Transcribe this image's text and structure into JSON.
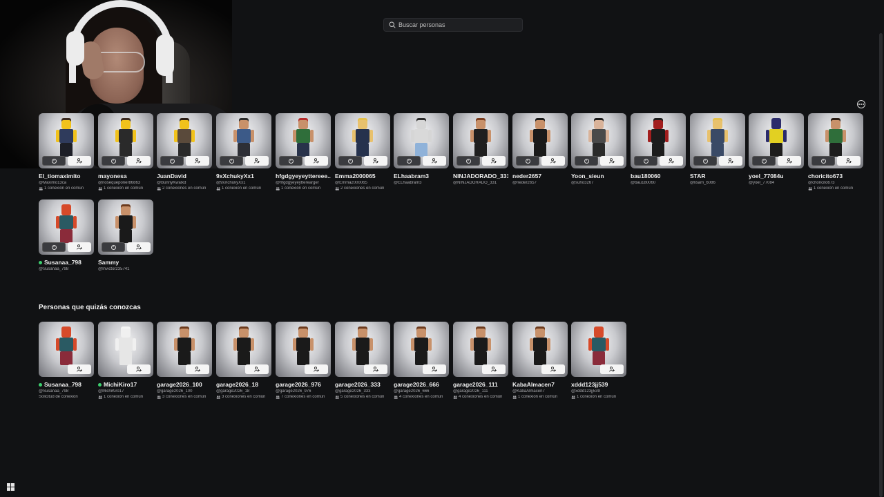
{
  "search": {
    "placeholder": "Buscar personas"
  },
  "colors": {
    "background": "#111214",
    "online": "#3ccf6e"
  },
  "requests": [
    {
      "name": "El_tiomaximito",
      "handle": "@Maximo13ca",
      "meta": "1 conexión en común",
      "head": "#f1c21b",
      "body": "#2f3b5c",
      "legs": "#1d1f27",
      "hair": "#3b2a1f"
    },
    {
      "name": "mayonesa",
      "handle": "@nosequeponer86863",
      "meta": "1 conexión en común",
      "head": "#f1c21b",
      "body": "#2a2a2a",
      "legs": "#2a2a2a",
      "hair": "#3b2a1f"
    },
    {
      "name": "JuanDavid",
      "handle": "@BunnyKwalxd",
      "meta": "2 conexiones en común",
      "head": "#f1c21b",
      "body": "#5a4a3b",
      "legs": "#2a2a2a",
      "hair": "#2b1d14"
    },
    {
      "name": "9xXchukyXx1",
      "handle": "@9xXchukyXx1",
      "meta": "1 conexión en común",
      "head": "#c8916a",
      "body": "#3c5a88",
      "legs": "#2d2f36",
      "hair": "#2a2a2a"
    },
    {
      "name": "hfgdgyeyeyttereee...",
      "handle": "@hfgdgyeyeytterearger",
      "meta": "1 conexión en común",
      "head": "#c8916a",
      "body": "#2f6e3a",
      "legs": "#28324a",
      "hair": "#b52a2a"
    },
    {
      "name": "Emma2000065",
      "handle": "@Emma2000065",
      "meta": "2 conexiones en común",
      "head": "#e8c16d",
      "body": "#26324d",
      "legs": "#26324d",
      "hair": "#e4c04a"
    },
    {
      "name": "ELhaabram3",
      "handle": "@ELhaabram3",
      "meta": "",
      "head": "#d6d6d6",
      "body": "#d9d9d9",
      "legs": "#8fb2d9",
      "hair": "#2a2a2a"
    },
    {
      "name": "NINJADORADO_331",
      "handle": "@NINJADORADO_331",
      "meta": "",
      "head": "#c8916a",
      "body": "#1f1f1f",
      "legs": "#1f1f1f",
      "hair": "#7a3c1d"
    },
    {
      "name": "neder2657",
      "handle": "@neder2657",
      "meta": "",
      "head": "#c8916a",
      "body": "#1a1a1a",
      "legs": "#1a1a1a",
      "hair": "#1a1a1a"
    },
    {
      "name": "Yoon_sieun",
      "handle": "@suho3267",
      "meta": "",
      "head": "#d9b39a",
      "body": "#4a4a4a",
      "legs": "#2a2a2a",
      "hair": "#1a1a1a"
    },
    {
      "name": "bau180060",
      "handle": "@bau180060",
      "meta": "",
      "head": "#a11e1e",
      "body": "#1c1c1c",
      "legs": "#1c1c1c",
      "hair": "#1c1c1c"
    },
    {
      "name": "STAR",
      "handle": "@lisam_6086",
      "meta": "",
      "head": "#e8c16d",
      "body": "#3a4a66",
      "legs": "#3a4a66",
      "hair": "#e4c04a"
    },
    {
      "name": "yoel_77084u",
      "handle": "@yoel_77084",
      "meta": "",
      "head": "#2b2b6b",
      "body": "#e2d022",
      "legs": "#1d1d1d",
      "hair": "#2b2b6b"
    },
    {
      "name": "choricito673",
      "handle": "@choricito673",
      "meta": "1 conexión en común",
      "head": "#c8916a",
      "body": "#2f6e3a",
      "legs": "#1d1d1d",
      "hair": "#2b1d14"
    },
    {
      "name": "Susanaa_798",
      "handle": "@Susanaa_798",
      "meta": "",
      "online": true,
      "head": "#d64a2a",
      "body": "#2a5a63",
      "legs": "#8a2b3a",
      "hair": "#d64a2a"
    },
    {
      "name": "Sammy",
      "handle": "@Invictor235741",
      "meta": "",
      "head": "#c8916a",
      "body": "#1a1a1a",
      "legs": "#1a1a1a",
      "hair": "#6b3a1d"
    }
  ],
  "suggestions_title": "Personas que quizás conozcas",
  "suggestions": [
    {
      "name": "Susanaa_798",
      "handle": "@Susanaa_798",
      "meta": "Solicitud de conexión",
      "online": true,
      "head": "#d64a2a",
      "body": "#2a5a63",
      "legs": "#8a2b3a",
      "hair": "#d64a2a"
    },
    {
      "name": "MichiKiro17",
      "handle": "@MichiKiro17",
      "meta": "1 conexión en común",
      "online": true,
      "head": "#f0f0f0",
      "body": "#e6e6e6",
      "legs": "#e6e6e6",
      "hair": "#f5f5f5"
    },
    {
      "name": "garage2026_100",
      "handle": "@garage2026_100",
      "meta": "3 conexiones en común",
      "head": "#c8916a",
      "body": "#1a1a1a",
      "legs": "#1a1a1a",
      "hair": "#6b3a1d"
    },
    {
      "name": "garage2026_18",
      "handle": "@garage2026_18",
      "meta": "3 conexiones en común",
      "head": "#c8916a",
      "body": "#1a1a1a",
      "legs": "#1a1a1a",
      "hair": "#6b3a1d"
    },
    {
      "name": "garage2026_976",
      "handle": "@garage2026_976",
      "meta": "7 conexiones en común",
      "head": "#c8916a",
      "body": "#1a1a1a",
      "legs": "#1a1a1a",
      "hair": "#6b3a1d"
    },
    {
      "name": "garage2026_333",
      "handle": "@garage2026_333",
      "meta": "5 conexiones en común",
      "head": "#c8916a",
      "body": "#1a1a1a",
      "legs": "#1a1a1a",
      "hair": "#6b3a1d"
    },
    {
      "name": "garage2026_666",
      "handle": "@garage2026_666",
      "meta": "4 conexiones en común",
      "head": "#c8916a",
      "body": "#1a1a1a",
      "legs": "#1a1a1a",
      "hair": "#6b3a1d"
    },
    {
      "name": "garage2026_111",
      "handle": "@garage2026_111",
      "meta": "4 conexiones en común",
      "head": "#c8916a",
      "body": "#1a1a1a",
      "legs": "#1a1a1a",
      "hair": "#6b3a1d"
    },
    {
      "name": "KabaAlmacen7",
      "handle": "@KabaAlmacen7",
      "meta": "1 conexión en común",
      "head": "#c8916a",
      "body": "#1a1a1a",
      "legs": "#1a1a1a",
      "hair": "#6b3a1d"
    },
    {
      "name": "xddd123jj539",
      "handle": "@xddd123jj539",
      "meta": "1 conexión en común",
      "head": "#d64a2a",
      "body": "#2a5a63",
      "legs": "#8a2b3a",
      "hair": "#d64a2a"
    }
  ]
}
